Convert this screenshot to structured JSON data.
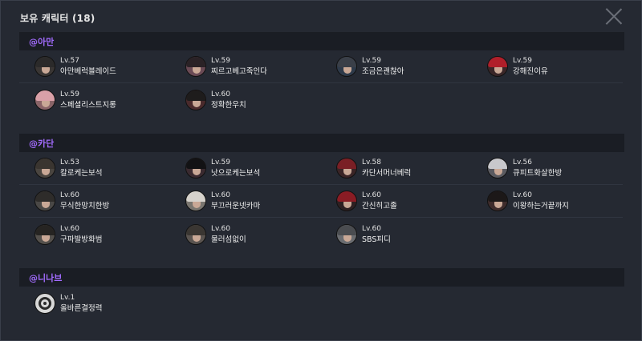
{
  "window": {
    "title": "보유 캐릭터 (18)"
  },
  "sections": [
    {
      "server": "@아만",
      "characters": [
        {
          "level": "Lv.57",
          "name": "아만베럭블레이드",
          "avatar": "character-portrait-icon",
          "hair": "#2b2a2a",
          "bg": "#3a3634"
        },
        {
          "level": "Lv.59",
          "name": "찌르고베고죽인다",
          "avatar": "character-portrait-icon",
          "hair": "#2a2226",
          "bg": "#6a4a55"
        },
        {
          "level": "Lv.59",
          "name": "조금은괜찮아",
          "avatar": "character-portrait-icon",
          "hair": "#3a3f48",
          "bg": "#2e3a4a"
        },
        {
          "level": "Lv.59",
          "name": "강해진이유",
          "avatar": "character-portrait-icon",
          "hair": "#b01f2a",
          "bg": "#3a2628"
        },
        {
          "level": "Lv.59",
          "name": "스페셜리스트지롱",
          "avatar": "character-portrait-icon",
          "hair": "#d9a0a8",
          "bg": "#8a6468"
        },
        {
          "level": "Lv.60",
          "name": "정확한우치",
          "avatar": "character-portrait-icon",
          "hair": "#1e1c1c",
          "bg": "#4a2a2c"
        }
      ]
    },
    {
      "server": "@카단",
      "characters": [
        {
          "level": "Lv.53",
          "name": "칼로케는보석",
          "avatar": "character-portrait-icon",
          "hair": "#3a3530",
          "bg": "#4a4540"
        },
        {
          "level": "Lv.59",
          "name": "낫으로케는보석",
          "avatar": "character-portrait-icon",
          "hair": "#121214",
          "bg": "#3a2a30"
        },
        {
          "level": "Lv.58",
          "name": "카단서머너베럭",
          "avatar": "character-portrait-icon",
          "hair": "#7a1f25",
          "bg": "#3a2426"
        },
        {
          "level": "Lv.56",
          "name": "큐피트화살한방",
          "avatar": "character-portrait-icon",
          "hair": "#c8c8cc",
          "bg": "#5a5a60"
        },
        {
          "level": "Lv.60",
          "name": "무식한망치한방",
          "avatar": "character-portrait-icon",
          "hair": "#2e2c2a",
          "bg": "#4a4846"
        },
        {
          "level": "Lv.60",
          "name": "부끄러운넷카마",
          "avatar": "character-portrait-icon",
          "hair": "#d6d2cc",
          "bg": "#7a7670"
        },
        {
          "level": "Lv.60",
          "name": "간신히고졸",
          "avatar": "character-portrait-icon",
          "hair": "#8a1c24",
          "bg": "#2e2022"
        },
        {
          "level": "Lv.60",
          "name": "이왕하는거끝까지",
          "avatar": "character-portrait-icon",
          "hair": "#1c1818",
          "bg": "#3e2c2c"
        },
        {
          "level": "Lv.60",
          "name": "구파발방화범",
          "avatar": "character-portrait-icon",
          "hair": "#262422",
          "bg": "#54504c"
        },
        {
          "level": "Lv.60",
          "name": "물러섬없이",
          "avatar": "character-portrait-icon",
          "hair": "#3a3632",
          "bg": "#5a5450"
        },
        {
          "level": "Lv.60",
          "name": "SBS피디",
          "avatar": "character-portrait-icon",
          "hair": "#4a4c50",
          "bg": "#6a6c70"
        }
      ]
    },
    {
      "server": "@니나브",
      "characters": [
        {
          "level": "Lv.1",
          "name": "올바른결정력",
          "avatar": "class-emblem-icon",
          "hair": "#2a2a2a",
          "bg": "#d8d8d8"
        }
      ]
    }
  ]
}
